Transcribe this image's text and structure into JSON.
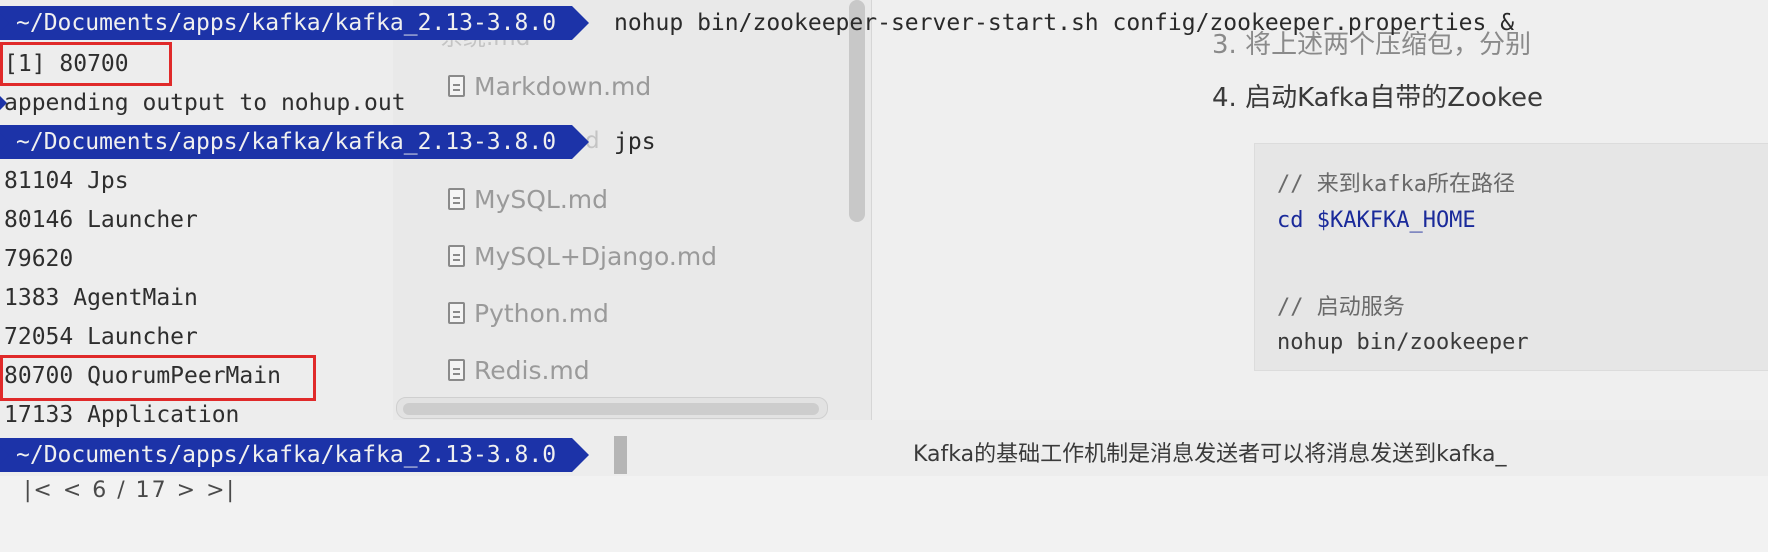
{
  "file_list": {
    "items": [
      {
        "name": "Markdown.md"
      },
      {
        "name": "MySQL.md"
      },
      {
        "name": "MySQL+Django.md"
      },
      {
        "name": "Python.md"
      },
      {
        "name": "Redis.md"
      }
    ],
    "ghost_partials": [
      "系统.md",
      "d"
    ]
  },
  "document": {
    "step3_partial": "3.  将上述两个压缩包，分别",
    "step4": "4.  启动Kafka自带的Zookee",
    "code": {
      "comment1": "// 来到kafka所在路径",
      "line_cd": "cd $KAKFKA_HOME",
      "comment2": "// 启动服务",
      "line_nohup": "nohup bin/zookeeper"
    },
    "footer_text": "Kafka的基础工作机制是消息发送者可以将消息发送到kafka_",
    "pager": "|<  <   6  /  17  >  >|"
  },
  "terminal": {
    "prompt_path": "~/Documents/apps/kafka/kafka_2.13-3.8.0",
    "cmd1": "nohup bin/zookeeper-server-start.sh config/zookeeper.properties &",
    "job_line": "[1] 80700",
    "append_line": "appending output to nohup.out",
    "cmd2": "jps",
    "jps_output": [
      "81104 Jps",
      "80146 Launcher",
      "79620",
      "1383 AgentMain",
      "72054 Launcher",
      "80700 QuorumPeerMain",
      "17133 Application"
    ],
    "highlight_color": "#e02a2a",
    "prompt_color": "#1c33a8"
  }
}
